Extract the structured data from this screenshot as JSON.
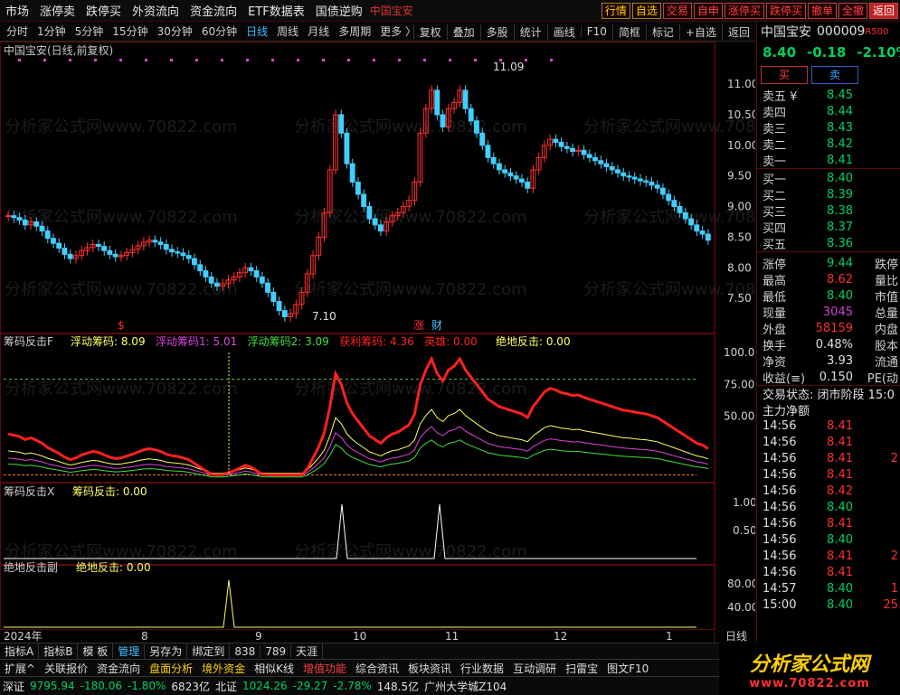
{
  "menubar": {
    "items": [
      "市场",
      "涨停卖",
      "跌停买",
      "外资流向",
      "资金流向",
      "ETF数据表",
      "国债逆购"
    ],
    "window_title": "中国宝安",
    "buttons": [
      "行情",
      "自选",
      "交易",
      "自申",
      "涨停买",
      "跌停买",
      "撤单",
      "全撤",
      "返回"
    ]
  },
  "periodbar": {
    "items": [
      "分时",
      "1分钟",
      "5分钟",
      "15分钟",
      "30分钟",
      "60分钟",
      "日线",
      "周线",
      "月线",
      "多周期",
      "更多 〉"
    ],
    "selected": "日线",
    "tools": [
      "复权",
      "叠加",
      "多股",
      "统计",
      "画线",
      "F10",
      "简框",
      "标记",
      "+自选",
      "返回"
    ]
  },
  "main_title": "中国宝安(日线,前复权)",
  "chart_data": [
    {
      "type": "candlestick",
      "name": "中国宝安 日线",
      "ylim": [
        7.0,
        11.4
      ],
      "yticks": [
        "11.00",
        "10.50",
        "10.00",
        "9.50",
        "9.00",
        "8.50",
        "8.00",
        "7.50"
      ],
      "annotations": [
        "11.09",
        "7.10"
      ],
      "x_labels": [
        "2024年",
        "8",
        "9",
        "10",
        "11",
        "12",
        "1"
      ],
      "closes": [
        8.85,
        8.82,
        8.78,
        8.7,
        8.75,
        8.68,
        8.6,
        8.48,
        8.4,
        8.32,
        8.22,
        8.15,
        8.2,
        8.28,
        8.33,
        8.38,
        8.35,
        8.28,
        8.22,
        8.18,
        8.2,
        8.25,
        8.3,
        8.36,
        8.42,
        8.45,
        8.42,
        8.38,
        8.3,
        8.26,
        8.24,
        8.2,
        8.15,
        8.05,
        7.95,
        7.85,
        7.75,
        7.7,
        7.74,
        7.8,
        7.85,
        7.92,
        8.0,
        7.95,
        7.85,
        7.75,
        7.6,
        7.45,
        7.3,
        7.2,
        7.25,
        7.4,
        7.6,
        7.9,
        8.2,
        8.5,
        8.9,
        9.6,
        10.5,
        10.2,
        9.7,
        9.4,
        9.2,
        9.0,
        8.8,
        8.7,
        8.6,
        8.75,
        8.85,
        8.9,
        9.0,
        9.1,
        9.4,
        10.2,
        10.6,
        10.9,
        10.5,
        10.3,
        10.6,
        10.7,
        10.9,
        10.6,
        10.4,
        10.2,
        10.0,
        9.8,
        9.7,
        9.6,
        9.55,
        9.5,
        9.45,
        9.4,
        9.3,
        9.6,
        9.8,
        10.0,
        10.1,
        10.05,
        9.98,
        9.95,
        9.9,
        9.92,
        9.85,
        9.8,
        9.75,
        9.7,
        9.65,
        9.6,
        9.55,
        9.5,
        9.48,
        9.45,
        9.42,
        9.4,
        9.35,
        9.3,
        9.2,
        9.1,
        9.0,
        8.9,
        8.8,
        8.7,
        8.6,
        8.55,
        8.45
      ]
    },
    {
      "type": "line",
      "name": "筹码反击F",
      "ylim": [
        0,
        110
      ],
      "yticks": [
        "100.0",
        "75.00",
        "50.00"
      ],
      "reference": 79,
      "legend": [
        "浮动筹码: 8.09",
        "浮动筹码1: 5.01",
        "浮动筹码2: 3.09",
        "获利筹码: 4.36",
        "英雄: 0.00",
        "绝地反击: 0.00"
      ],
      "series": [
        {
          "name": "获利筹码",
          "color": "#ff2020"
        },
        {
          "name": "浮动筹码",
          "color": "#ffff60"
        },
        {
          "name": "浮动筹码1",
          "color": "#e040e0"
        },
        {
          "name": "浮动筹码2",
          "color": "#40e040"
        }
      ]
    },
    {
      "type": "line",
      "name": "筹码反击X",
      "legend": "筹码反击: 0.00",
      "yticks": [
        "1.00",
        "0.50"
      ]
    },
    {
      "type": "line",
      "name": "绝地反击副",
      "legend": "绝地反击: 0.00",
      "yticks": [
        "80.00",
        "40.00"
      ]
    }
  ],
  "marks": {
    "s": "$",
    "zhang": "涨",
    "cai": "财"
  },
  "watermark": "分析家公式网www.70822.com",
  "quote": {
    "name": "中国宝安",
    "code": "000009",
    "tag": "R500",
    "price": "8.40",
    "change": "-0.18",
    "pct": "-2.10%",
    "buy": "买",
    "sell": "卖",
    "asks": [
      [
        "卖五 ¥",
        "8.45"
      ],
      [
        "卖四",
        "8.44"
      ],
      [
        "卖三",
        "8.43"
      ],
      [
        "卖二",
        "8.42"
      ],
      [
        "卖一",
        "8.41"
      ]
    ],
    "bids": [
      [
        "买一",
        "8.40"
      ],
      [
        "买二",
        "8.39"
      ],
      [
        "买三",
        "8.38"
      ],
      [
        "买四",
        "8.37"
      ],
      [
        "买五",
        "8.36"
      ]
    ],
    "stats": [
      [
        "涨停",
        "9.44",
        "跌停"
      ],
      [
        "最高",
        "8.62",
        "量比"
      ],
      [
        "最低",
        "8.40",
        "市值"
      ],
      [
        "现量",
        "3045",
        "总量"
      ],
      [
        "外盘",
        "58159",
        "内盘"
      ],
      [
        "换手",
        "0.48%",
        "股本"
      ],
      [
        "净资",
        "3.93",
        "流通"
      ],
      [
        "收益(≡)",
        "0.150",
        "PE(动"
      ]
    ],
    "state": "交易状态: 闭市阶段 15:0",
    "netflow": "主力净额",
    "ticks": [
      [
        "14:56",
        "8.41"
      ],
      [
        "14:56",
        "8.41"
      ],
      [
        "14:56",
        "8.41"
      ],
      [
        "14:56",
        "8.41"
      ],
      [
        "14:56",
        "8.42"
      ],
      [
        "14:56",
        "8.40"
      ],
      [
        "14:56",
        "8.41"
      ],
      [
        "14:56",
        "8.40"
      ],
      [
        "14:56",
        "8.41"
      ],
      [
        "14:56",
        "8.41"
      ],
      [
        "14:57",
        "8.40"
      ],
      [
        "15:00",
        "8.40"
      ]
    ],
    "tick_right": [
      "",
      "",
      "2",
      "",
      "",
      "",
      "",
      "",
      "2",
      "",
      "1",
      "25"
    ]
  },
  "bottom1": [
    "指标A",
    "指标B",
    "模 板",
    "管理",
    "另存为",
    "绑定到",
    "838",
    "789",
    "天涯"
  ],
  "bottom1_selected": "管理",
  "bottom2": [
    "扩展^",
    "关联报价",
    "资金流向",
    "盘面分析",
    "境外资金",
    "相似K线",
    "增值功能",
    "综合资讯",
    "板块资讯",
    "行业数据",
    "互动调研",
    "扫雷宝",
    "图文F10"
  ],
  "status": {
    "sz": "深证",
    "sz_val": "9795.94",
    "sz_chg": "-180.06",
    "sz_pct": "-1.80%",
    "sz_amt": "6823亿",
    "bz": "北证",
    "bz_val": "1024.26",
    "bz_chg": "-29.27",
    "bz_pct": "-2.78%",
    "bz_amt": "148.5亿",
    "loc": "广州大学城Z104"
  },
  "brand": {
    "name": "分析家公式网",
    "url": "www.70822.com"
  },
  "right_label": "日线"
}
